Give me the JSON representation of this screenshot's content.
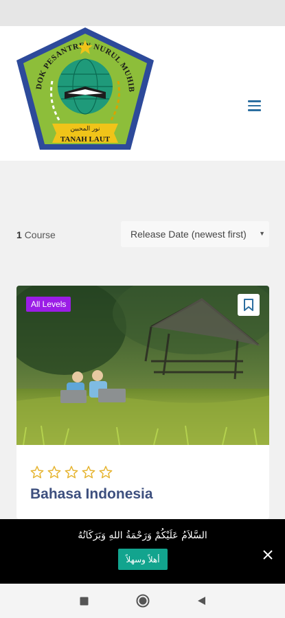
{
  "header": {
    "logo": {
      "arc_text": "PONDOK PESANTREN NURUL MUHIBBIN",
      "arabic_text": "نور المحبين",
      "bottom_text": "TANAH LAUT"
    },
    "menu_icon": "hamburger-menu-icon"
  },
  "listing": {
    "count": "1",
    "count_label": "Course",
    "sort": {
      "selected": "Release Date (newest first)"
    }
  },
  "course": {
    "level_badge": "All Levels",
    "title": "Bahasa Indonesia",
    "rating": {
      "value": 0,
      "max": 5
    }
  },
  "banner": {
    "greeting": "السَّلاَمُ عَلَيْكُمْ وَرَحْمَةُ اللهِ وَبَرَكَاتُهُ",
    "accept_label": "أهلاً وسهلاً"
  },
  "colors": {
    "accent": "#2b6ea0",
    "badge": "#9b1de6",
    "title": "#3d4f7e",
    "star": "#e6b430",
    "button": "#12a48e"
  }
}
